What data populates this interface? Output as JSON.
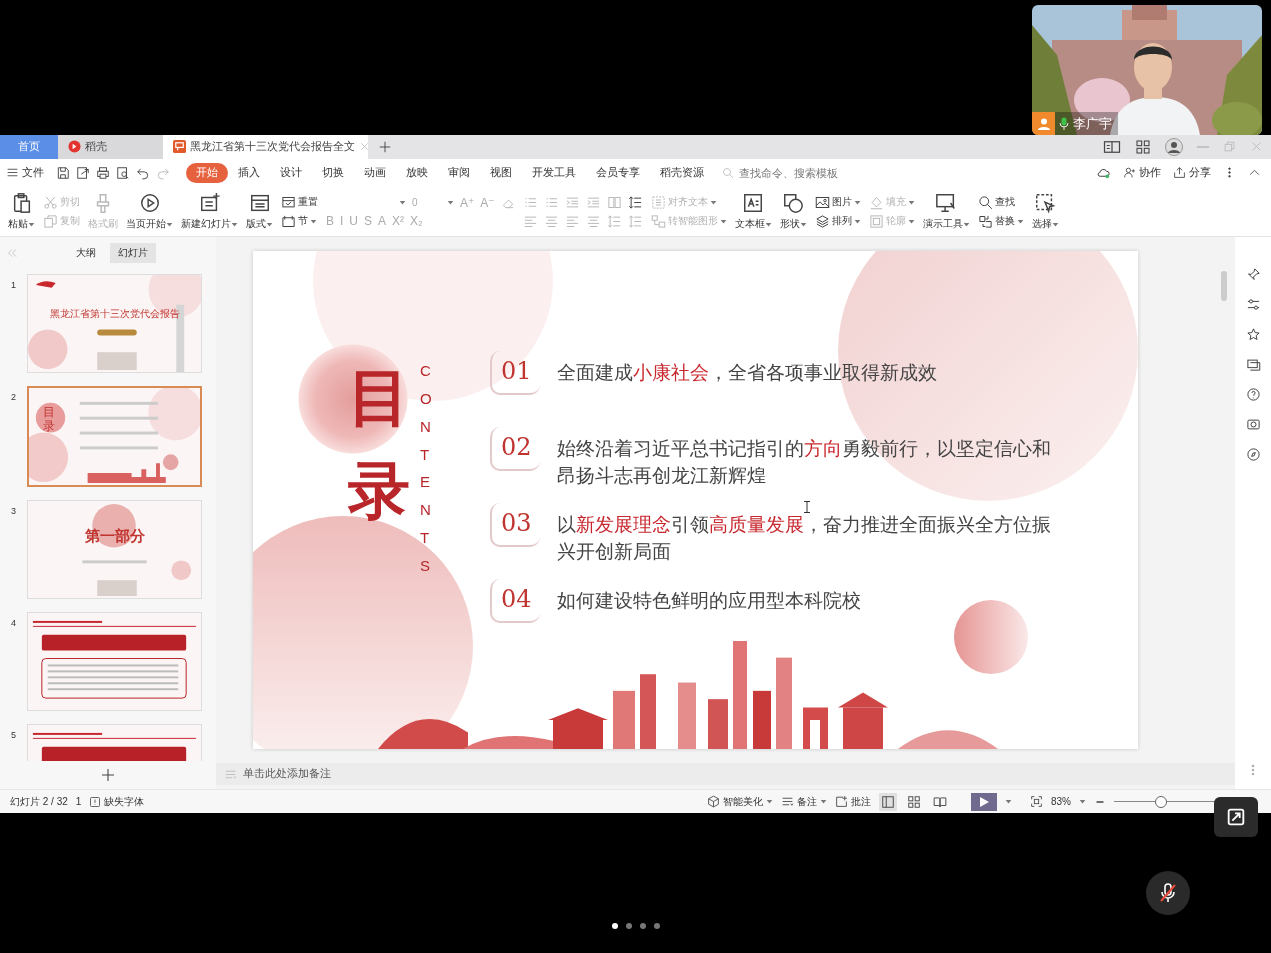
{
  "document_tabs": [
    {
      "label": "首页",
      "kind": "home",
      "selected": false
    },
    {
      "label": "稻壳",
      "kind": "store",
      "selected": false
    },
    {
      "label": "黑龙江省第十三次党代会报告全文",
      "kind": "document",
      "selected": true
    }
  ],
  "menu": {
    "file": "文件",
    "tabs": [
      {
        "label": "开始",
        "selected": true
      },
      {
        "label": "插入",
        "selected": false
      },
      {
        "label": "设计",
        "selected": false
      },
      {
        "label": "切换",
        "selected": false
      },
      {
        "label": "动画",
        "selected": false
      },
      {
        "label": "放映",
        "selected": false
      },
      {
        "label": "审阅",
        "selected": false
      },
      {
        "label": "视图",
        "selected": false
      },
      {
        "label": "开发工具",
        "selected": false
      },
      {
        "label": "会员专享",
        "selected": false
      },
      {
        "label": "稻壳资源",
        "selected": false
      }
    ],
    "search_placeholder": "查找命令、搜索模板",
    "actions": [
      "协作",
      "分享"
    ]
  },
  "ribbon": [
    {
      "kind": "large",
      "label": "粘贴",
      "dropdown": true,
      "disabled": false
    },
    {
      "kind": "pair",
      "items": [
        {
          "label": "剪切",
          "dropdown": false,
          "disabled": true
        },
        {
          "label": "复制",
          "dropdown": false,
          "disabled": true
        }
      ]
    },
    {
      "kind": "large",
      "label": "格式刷",
      "dropdown": false,
      "disabled": true
    },
    {
      "kind": "large",
      "label": "当页开始",
      "dropdown": true,
      "disabled": false
    },
    {
      "kind": "large",
      "label": "新建幻灯片",
      "dropdown": true,
      "disabled": false
    },
    {
      "kind": "large",
      "label": "版式",
      "dropdown": true,
      "disabled": false
    },
    {
      "kind": "pair",
      "items": [
        {
          "label": "重置",
          "dropdown": false,
          "disabled": false
        },
        {
          "label": "节",
          "dropdown": true,
          "disabled": false
        }
      ]
    },
    {
      "kind": "font",
      "size": "0",
      "grow": "A⁺",
      "shrink": "A⁻",
      "styles": [
        "B",
        "I",
        "U",
        "S",
        "A",
        "X²",
        "X₂"
      ]
    },
    {
      "kind": "paragraph"
    },
    {
      "kind": "pair",
      "items": [
        {
          "label": "对齐文本",
          "dropdown": true,
          "disabled": true
        },
        {
          "label": "转智能图形",
          "dropdown": true,
          "disabled": true
        }
      ]
    },
    {
      "kind": "large",
      "label": "文本框",
      "dropdown": true,
      "disabled": false
    },
    {
      "kind": "large",
      "label": "形状",
      "dropdown": true,
      "disabled": false
    },
    {
      "kind": "pair",
      "items": [
        {
          "label": "图片",
          "dropdown": true,
          "disabled": false
        },
        {
          "label": "排列",
          "dropdown": true,
          "disabled": false
        }
      ]
    },
    {
      "kind": "pair",
      "items": [
        {
          "label": "填充",
          "dropdown": true,
          "disabled": true
        },
        {
          "label": "轮廓",
          "dropdown": true,
          "disabled": true
        }
      ]
    },
    {
      "kind": "large",
      "label": "演示工具",
      "dropdown": true,
      "disabled": false
    },
    {
      "kind": "pair",
      "items": [
        {
          "label": "查找",
          "dropdown": false,
          "disabled": false
        },
        {
          "label": "替换",
          "dropdown": true,
          "disabled": false
        }
      ]
    },
    {
      "kind": "large",
      "label": "选择",
      "dropdown": true,
      "disabled": false
    }
  ],
  "panel": {
    "tabs": [
      {
        "label": "大纲",
        "selected": false
      },
      {
        "label": "幻灯片",
        "selected": true
      }
    ],
    "thumbnails": [
      {
        "number": "1",
        "kind": "title",
        "title": "黑龙江省第十三次党代会报告",
        "selected": false
      },
      {
        "number": "2",
        "kind": "contents",
        "title": "目录",
        "selected": true
      },
      {
        "number": "3",
        "kind": "section",
        "title": "第一部分",
        "selected": false
      },
      {
        "number": "4",
        "kind": "text",
        "selected": false
      },
      {
        "number": "5",
        "kind": "text",
        "selected": false
      }
    ]
  },
  "slide": {
    "title": "目录",
    "subtitle": "CONTENTS",
    "items": [
      {
        "number": "01",
        "parts": [
          {
            "text": "全面建成",
            "highlight": false
          },
          {
            "text": "小康社会",
            "highlight": true
          },
          {
            "text": "，全省各项事业取得新成效",
            "highlight": false
          }
        ]
      },
      {
        "number": "02",
        "parts": [
          {
            "text": "始终沿着习近平总书记指引的",
            "highlight": false
          },
          {
            "text": "方向",
            "highlight": true
          },
          {
            "text": "勇毅前行，以坚定信心和昂扬斗志再创龙江新辉煌",
            "highlight": false
          }
        ]
      },
      {
        "number": "03",
        "parts": [
          {
            "text": "以",
            "highlight": false
          },
          {
            "text": "新发展理念",
            "highlight": true
          },
          {
            "text": "引领",
            "highlight": false
          },
          {
            "text": "高质量发展",
            "highlight": true
          },
          {
            "text": "，奋力推进全面振兴全方位振兴开创新局面",
            "highlight": false
          }
        ]
      },
      {
        "number": "04",
        "parts": [
          {
            "text": "如何建设特色鲜明的应用型本科院校",
            "highlight": false
          }
        ]
      }
    ]
  },
  "notes_placeholder": "单击此处添加备注",
  "status_bar": {
    "slide": "幻灯片 2 / 32",
    "page": "1",
    "missing_fonts": "缺失字体",
    "beautify": "智能美化",
    "notes": "备注",
    "comments": "批注",
    "views": [
      {
        "selected": true
      },
      {
        "selected": false
      },
      {
        "selected": false
      }
    ],
    "zoom": "83%",
    "zoom_slider": {
      "level": 0.45
    }
  },
  "webcam": {
    "name": "李广宇",
    "muted": false
  },
  "mic": {
    "muted": true
  },
  "page_dots": [
    {
      "selected": true
    },
    {
      "selected": false
    },
    {
      "selected": false
    },
    {
      "selected": false
    }
  ]
}
